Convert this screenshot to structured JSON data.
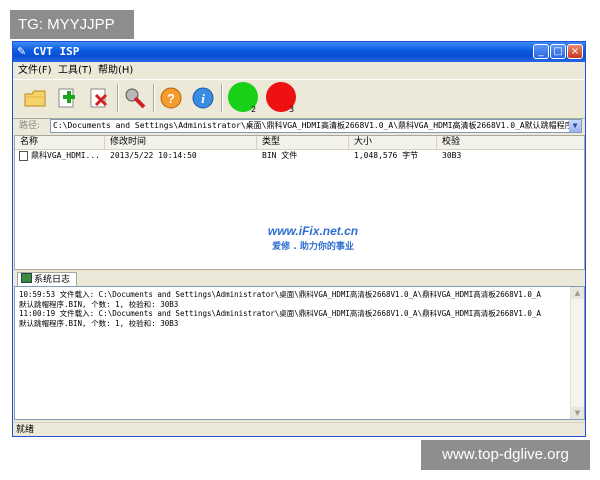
{
  "overlay": {
    "tg_label": "TG: MYYJJPP",
    "site_watermark": "www.top-dglive.org"
  },
  "window": {
    "title": "CVT ISP",
    "min_icon": "minimize-icon",
    "max_icon": "maximize-icon",
    "close_icon": "close-icon"
  },
  "menu": {
    "file": "文件(F)",
    "tools": "工具(T)",
    "help": "帮助(H)"
  },
  "toolbar": {
    "indicators": [
      {
        "color": "#18d018",
        "number": "2"
      },
      {
        "color": "#ee1111",
        "number": "3"
      }
    ]
  },
  "path": {
    "label": "路径:",
    "value": "C:\\Documents and Settings\\Administrator\\桌面\\鼎科VGA_HDMI高清板2668V1.0_A\\鼎科VGA_HDMI高清板2668V1.0_A默认跳帽程序"
  },
  "list": {
    "columns": [
      "名称",
      "修改时间",
      "类型",
      "大小",
      "校验"
    ],
    "rows": [
      {
        "name": "鼎科VGA_HDMI...",
        "modified": "2013/5/22 10:14:50",
        "type": "BIN 文件",
        "size": "1,048,576 字节",
        "checksum": "30B3"
      }
    ]
  },
  "watermark": {
    "main": "www.iFix.net.cn",
    "sub": "爱修 . 助力你的事业"
  },
  "log": {
    "tab_label": "系统日志",
    "lines": [
      "10:59:53 文件载入: C:\\Documents and Settings\\Administrator\\桌面\\鼎科VGA_HDMI高清板2668V1.0_A\\鼎科VGA_HDMI高清板2668V1.0_A",
      "默认跳帽程序.BIN, 个数: 1, 校验和: 30B3",
      "11:00:19 文件载入: C:\\Documents and Settings\\Administrator\\桌面\\鼎科VGA_HDMI高清板2668V1.0_A\\鼎科VGA_HDMI高清板2668V1.0_A",
      "默认跳帽程序.BIN, 个数: 1, 校验和: 30B3"
    ]
  },
  "status": {
    "text": "就绪"
  }
}
